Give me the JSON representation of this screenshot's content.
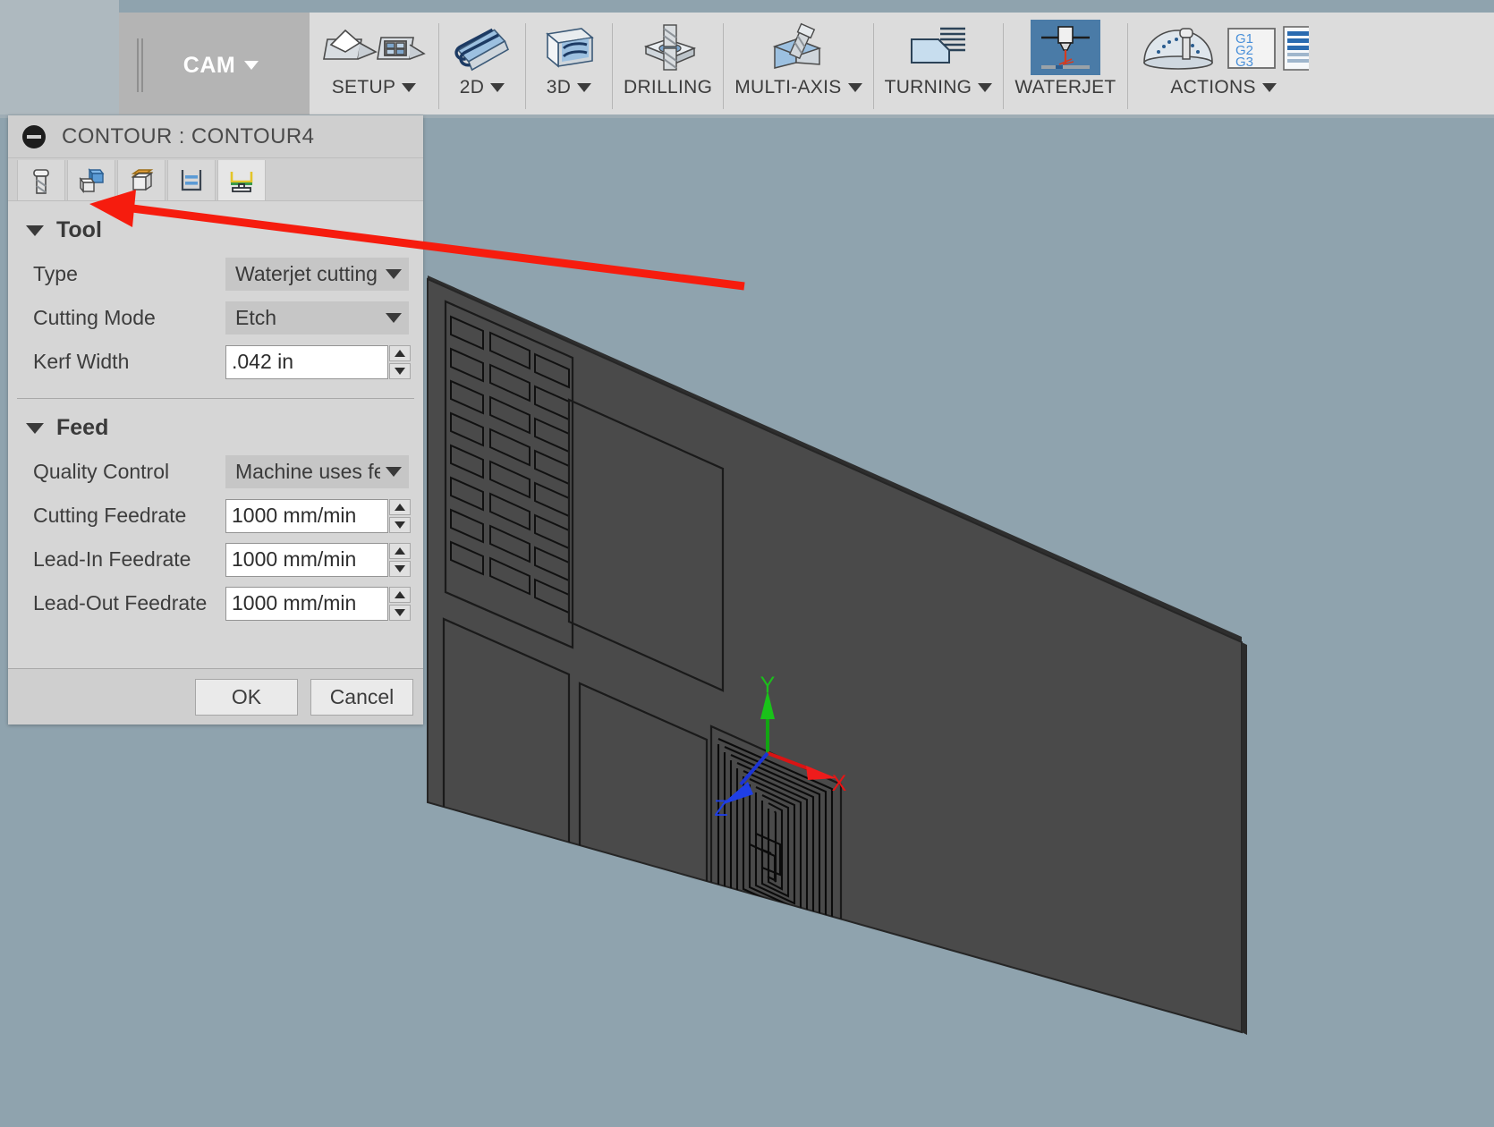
{
  "ribbon": {
    "workspace": {
      "label": "CAM",
      "icon": "chevron-down-icon"
    },
    "groups": [
      {
        "label": "SETUP",
        "icon": "setup-icon",
        "has_dropdown": true
      },
      {
        "label": "2D",
        "icon": "toolpath-2d-icon",
        "has_dropdown": true
      },
      {
        "label": "3D",
        "icon": "toolpath-3d-icon",
        "has_dropdown": true
      },
      {
        "label": "DRILLING",
        "icon": "drilling-icon",
        "has_dropdown": false
      },
      {
        "label": "MULTI-AXIS",
        "icon": "multi-axis-icon",
        "has_dropdown": true
      },
      {
        "label": "TURNING",
        "icon": "turning-icon",
        "has_dropdown": true
      },
      {
        "label": "WATERJET",
        "icon": "waterjet-icon",
        "has_dropdown": false,
        "selected": true
      },
      {
        "label": "ACTIONS",
        "icon": "actions-icon",
        "has_dropdown": true
      }
    ],
    "setup_extra_icon": "setup-folder-icon",
    "actions_extra_icons": [
      "gcode-g1g2g3-icon",
      "post-process-icon"
    ]
  },
  "dialog": {
    "title": "CONTOUR : CONTOUR4",
    "minimize_icon": "minimize-icon",
    "tabs": [
      {
        "name": "tool-tab",
        "icon": "endmill-tool-icon",
        "active": false
      },
      {
        "name": "geometry-tab",
        "icon": "blue-cube-geometry-icon",
        "active": false
      },
      {
        "name": "heights-tab",
        "icon": "orange-top-cube-icon",
        "active": false
      },
      {
        "name": "passes-tab",
        "icon": "passes-layers-icon",
        "active": false
      },
      {
        "name": "linking-tab",
        "icon": "linking-leads-icon",
        "active": true
      }
    ],
    "sections": [
      {
        "name": "tool",
        "title": "Tool",
        "collapsed": false,
        "fields": [
          {
            "name": "type",
            "label": "Type",
            "kind": "combo",
            "value": "Waterjet cutting"
          },
          {
            "name": "cutting-mode",
            "label": "Cutting Mode",
            "kind": "combo",
            "value": "Etch"
          },
          {
            "name": "kerf-width",
            "label": "Kerf Width",
            "kind": "spin",
            "value": ".042 in"
          }
        ]
      },
      {
        "name": "feed",
        "title": "Feed",
        "collapsed": false,
        "fields": [
          {
            "name": "quality-control",
            "label": "Quality Control",
            "kind": "combo",
            "value": "Machine uses fe..."
          },
          {
            "name": "cutting-feedrate",
            "label": "Cutting Feedrate",
            "kind": "spin",
            "value": "1000 mm/min"
          },
          {
            "name": "lead-in-feedrate",
            "label": "Lead-In Feedrate",
            "kind": "spin",
            "value": "1000 mm/min"
          },
          {
            "name": "lead-out-feedrate",
            "label": "Lead-Out Feedrate",
            "kind": "spin",
            "value": "1000 mm/min"
          }
        ]
      }
    ],
    "buttons": {
      "ok": "OK",
      "cancel": "Cancel"
    }
  },
  "viewport": {
    "background_color": "#8fa3ae",
    "model_face_color": "#4a4a4a",
    "origin_triad": {
      "x_label": "X",
      "x_color": "#e01b1b",
      "y_label": "Y",
      "y_color": "#16b616",
      "z_label": "Z",
      "z_color": "#1a3fe0"
    },
    "toolpath": {
      "name": "etch-spiral-toolpath",
      "color": "#0c0c0c"
    }
  },
  "annotation": {
    "arrow_color": "#f61c0e",
    "points_to": "geometry-tab"
  }
}
